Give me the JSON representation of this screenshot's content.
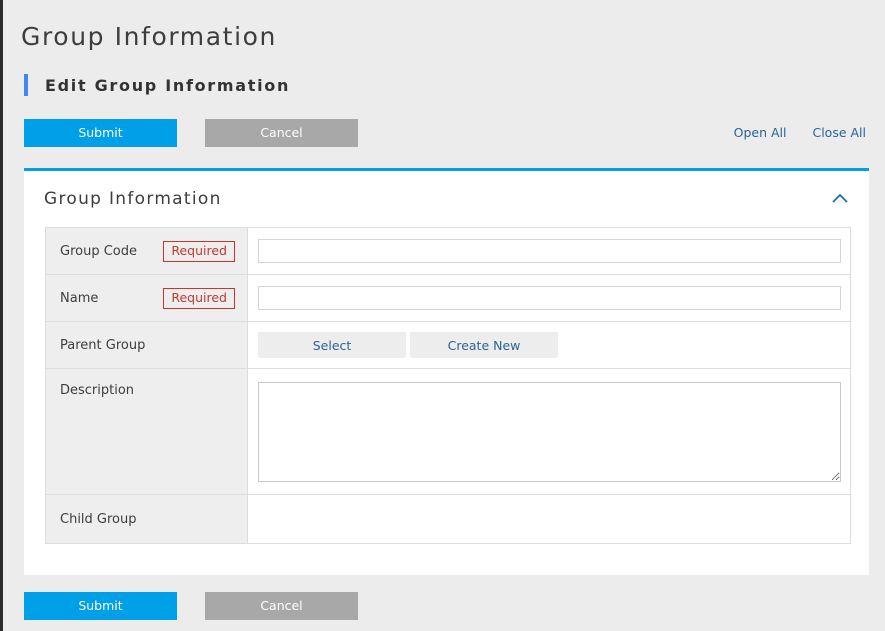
{
  "header": {
    "page_title": "Group Information",
    "subtitle": "Edit Group Information",
    "accent_color": "#4285f4"
  },
  "toolbar": {
    "submit_label": "Submit",
    "cancel_label": "Cancel",
    "open_all_label": "Open All",
    "close_all_label": "Close All",
    "submit_color": "#00a0e9",
    "cancel_color": "#a8a8a8"
  },
  "panel": {
    "title": "Group Information",
    "collapse_icon": "chevron-up-icon",
    "accent_color": "#00a0e9"
  },
  "form": {
    "required_badge": "Required",
    "rows": [
      {
        "label": "Group Code",
        "required": "Required",
        "type": "text",
        "value": "",
        "placeholder": ""
      },
      {
        "label": "Name",
        "required": "Required",
        "type": "text",
        "value": "",
        "placeholder": ""
      },
      {
        "label": "Parent Group",
        "required": "",
        "type": "buttons",
        "buttons": [
          "Select",
          "Create New"
        ]
      },
      {
        "label": "Description",
        "required": "",
        "type": "textarea",
        "value": "",
        "placeholder": ""
      },
      {
        "label": "Child Group",
        "required": "",
        "type": "empty",
        "value": ""
      }
    ]
  },
  "footer": {
    "submit_label": "Submit",
    "cancel_label": "Cancel"
  }
}
